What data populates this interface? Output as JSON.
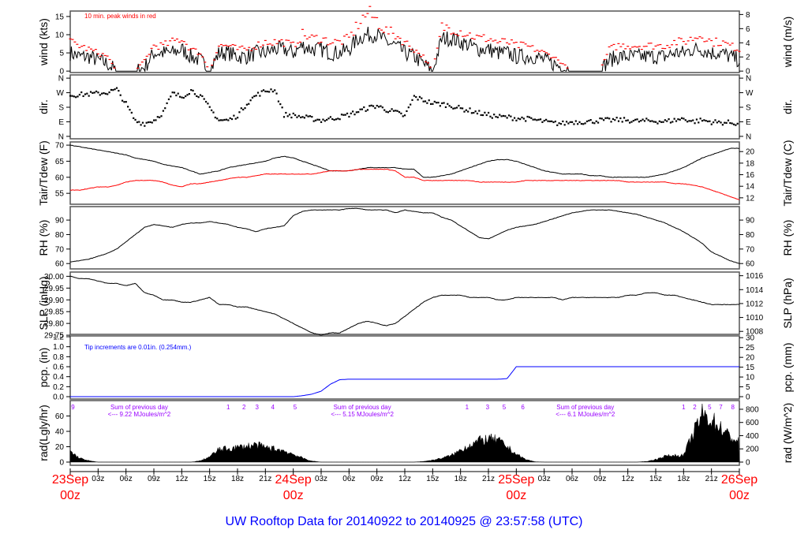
{
  "title": "UW Rooftop Data for 20140922  to  20140925 @ 23:57:58  (UTC)",
  "time_axis": {
    "hours": 72,
    "tick_labels": [
      "03z",
      "06z",
      "09z",
      "12z",
      "15z",
      "18z",
      "21z",
      "03z",
      "06z",
      "09z",
      "12z",
      "15z",
      "18z",
      "21z",
      "03z",
      "06z",
      "09z",
      "12z",
      "15z",
      "18z",
      "21z"
    ],
    "tick_hours": [
      3,
      6,
      9,
      12,
      15,
      18,
      21,
      27,
      30,
      33,
      36,
      39,
      42,
      45,
      51,
      54,
      57,
      60,
      63,
      66,
      69
    ],
    "day_labels": [
      {
        "hour": 0,
        "day": "23Sep",
        "time": "00z"
      },
      {
        "hour": 24,
        "day": "24Sep",
        "time": "00z"
      },
      {
        "hour": 48,
        "day": "25Sep",
        "time": "00z"
      },
      {
        "hour": 72,
        "day": "26Sep",
        "time": "00z"
      }
    ]
  },
  "colors": {
    "main": "#000000",
    "peak": "#ff0000",
    "dew": "#ff0000",
    "pcp": "#0000ff",
    "rad_note": "#9900ff",
    "day": "#ff0000",
    "title": "#0000ff"
  },
  "chart_data": [
    {
      "id": "wind",
      "type": "line",
      "ylabel": "wind (kts)",
      "ylabel_right": "wind (m/s)",
      "yticks": [
        0,
        5,
        10,
        15
      ],
      "yticks_right": [
        0,
        2,
        4,
        6,
        8
      ],
      "ylim": [
        -0.4,
        16.5
      ],
      "annotation": "10 min. peak winds in red",
      "series": [
        {
          "name": "wind",
          "values": [
            5,
            4,
            4,
            3,
            2,
            0,
            0,
            0,
            1,
            5,
            5,
            5,
            6,
            4,
            3,
            0,
            5,
            5,
            4,
            4,
            5,
            5,
            6,
            6,
            5,
            7,
            6,
            6,
            5,
            5,
            6,
            9,
            10,
            10,
            8,
            7,
            5,
            4,
            2,
            0,
            9,
            9,
            8,
            7,
            6,
            6,
            5,
            5,
            4,
            4,
            4,
            3,
            2,
            1,
            0,
            0,
            0,
            0,
            3,
            4,
            4,
            4,
            4,
            4,
            4,
            5,
            5,
            6,
            6,
            5,
            5,
            4,
            3
          ]
        },
        {
          "name": "peak",
          "values": [
            8,
            7,
            6,
            5,
            4,
            0,
            0,
            0,
            3,
            7,
            7,
            8,
            9,
            6,
            5,
            0,
            7,
            7,
            6,
            6,
            7,
            8,
            8,
            8,
            7,
            10,
            9,
            9,
            8,
            8,
            9,
            13,
            16,
            14,
            11,
            10,
            8,
            6,
            4,
            0,
            12,
            12,
            11,
            10,
            9,
            9,
            8,
            8,
            7,
            7,
            6,
            5,
            4,
            2,
            0,
            0,
            0,
            0,
            6,
            7,
            7,
            7,
            7,
            7,
            7,
            8,
            8,
            9,
            10,
            8,
            8,
            7,
            6
          ]
        }
      ]
    },
    {
      "id": "dir",
      "type": "scatter",
      "ylabel": "dir.",
      "ylabel_right": "dir.",
      "yticks": [
        0,
        90,
        180,
        270,
        360
      ],
      "ytick_labels": [
        "N",
        "E",
        "S",
        "W",
        "N"
      ],
      "ylim": [
        -15,
        380
      ],
      "series": [
        {
          "name": "direction",
          "values": [
            255,
            258,
            262,
            266,
            272,
            290,
            200,
            95,
            80,
            100,
            150,
            265,
            245,
            285,
            250,
            175,
            100,
            100,
            130,
            205,
            255,
            280,
            292,
            135,
            130,
            120,
            110,
            100,
            110,
            120,
            135,
            155,
            175,
            190,
            165,
            150,
            125,
            245,
            225,
            205,
            200,
            190,
            172,
            160,
            145,
            132,
            122,
            120,
            112,
            110,
            102,
            92,
            82,
            80,
            90,
            90,
            92,
            100,
            100,
            102,
            100,
            95,
            96,
            95,
            92,
            100,
            110,
            92,
            100,
            90,
            86,
            85,
            80
          ]
        }
      ]
    },
    {
      "id": "temp",
      "type": "line",
      "ylabel": "Tair/Tdew (F)",
      "ylabel_right": "Tair/Tdew (C)",
      "yticks": [
        55,
        60,
        65,
        70
      ],
      "yticks_right": [
        12,
        14,
        16,
        18,
        20
      ],
      "ylim": [
        51.6,
        71
      ],
      "series": [
        {
          "name": "Tair",
          "values": [
            70,
            69.5,
            69,
            68.5,
            68,
            67.5,
            67,
            66,
            65.5,
            65,
            64,
            63.5,
            63,
            62,
            61,
            61.5,
            62,
            63,
            63.5,
            64,
            64.5,
            65,
            66,
            66.5,
            66,
            65,
            64,
            63,
            62,
            62,
            62,
            62.5,
            63,
            63,
            63,
            63,
            62.5,
            62.5,
            60,
            60,
            60.5,
            61,
            62,
            63,
            64,
            65,
            65.5,
            65.5,
            65,
            64,
            63,
            62,
            61.5,
            61,
            61,
            61,
            60.5,
            60.5,
            60,
            60,
            60,
            60,
            60,
            60.5,
            61,
            62,
            63,
            64.5,
            66,
            67,
            68,
            69,
            69
          ]
        },
        {
          "name": "Tdew",
          "values": [
            56,
            56,
            56.5,
            57,
            57,
            57.5,
            58.5,
            59,
            59,
            59,
            58.5,
            57.5,
            57,
            58,
            58,
            58.5,
            59,
            59.5,
            60,
            60,
            60.5,
            61,
            61,
            61,
            61,
            61,
            61,
            61.5,
            62,
            62,
            62,
            62.5,
            62.5,
            62.5,
            62.5,
            62,
            60,
            60,
            59,
            59,
            59,
            59,
            59,
            59,
            58.5,
            58.5,
            58.5,
            58.5,
            58.5,
            59,
            59,
            59,
            59,
            59,
            59,
            59,
            59,
            59,
            59,
            59,
            58.5,
            58.5,
            58.5,
            58.5,
            58.5,
            58,
            58,
            57.5,
            57,
            56,
            55,
            54,
            53
          ]
        }
      ]
    },
    {
      "id": "rh",
      "type": "line",
      "ylabel": "RH (%)",
      "ylabel_right": "RH (%)",
      "yticks": [
        60,
        70,
        80,
        90
      ],
      "yticks_right": [
        60,
        70,
        80,
        90
      ],
      "ylim": [
        56.3,
        99.3
      ],
      "series": [
        {
          "name": "RH",
          "values": [
            61,
            62,
            63,
            65,
            67,
            70,
            75,
            80,
            85,
            87,
            86,
            85,
            87,
            88,
            88,
            89,
            88,
            87,
            85,
            84,
            82,
            84,
            85,
            86,
            93,
            96,
            97,
            97,
            97,
            97,
            98,
            98,
            97,
            97,
            97,
            95,
            97,
            96,
            95,
            95,
            92,
            90,
            86,
            82,
            78,
            77,
            80,
            83,
            85,
            86,
            87,
            89,
            91,
            93,
            95,
            96,
            97,
            97,
            97,
            96,
            95,
            94,
            92,
            90,
            88,
            85,
            82,
            78,
            74,
            68,
            65,
            62,
            60
          ]
        }
      ]
    },
    {
      "id": "slp",
      "type": "line",
      "ylabel": "SLP (inHg)",
      "ylabel_right": "SLP (hPa)",
      "yticks": [
        29.75,
        29.8,
        29.85,
        29.9,
        29.95,
        30.0
      ],
      "yticks_right": [
        1008,
        1010,
        1012,
        1014,
        1016
      ],
      "ylim": [
        29.7536,
        30.018
      ],
      "series": [
        {
          "name": "SLP",
          "values": [
            30.0,
            29.99,
            29.99,
            29.98,
            29.97,
            29.97,
            29.96,
            29.97,
            29.93,
            29.92,
            29.9,
            29.9,
            29.89,
            29.89,
            29.9,
            29.91,
            29.88,
            29.88,
            29.87,
            29.87,
            29.86,
            29.85,
            29.84,
            29.82,
            29.8,
            29.78,
            29.76,
            29.75,
            29.76,
            29.76,
            29.78,
            29.8,
            29.81,
            29.8,
            29.79,
            29.8,
            29.83,
            29.86,
            29.89,
            29.91,
            29.92,
            29.92,
            29.92,
            29.91,
            29.91,
            29.91,
            29.9,
            29.9,
            29.91,
            29.91,
            29.91,
            29.91,
            29.91,
            29.9,
            29.91,
            29.91,
            29.91,
            29.91,
            29.91,
            29.91,
            29.92,
            29.92,
            29.93,
            29.93,
            29.92,
            29.92,
            29.91,
            29.9,
            29.89,
            29.88,
            29.88,
            29.88,
            29.88
          ]
        }
      ]
    },
    {
      "id": "pcp",
      "type": "line",
      "ylabel": "pcp. (in)",
      "ylabel_right": "pcp. (mm)",
      "yticks": [
        0.0,
        0.2,
        0.4,
        0.6,
        0.8,
        1.0,
        1.2
      ],
      "ytick_labels": [
        "0.0",
        "0.2",
        "0.4",
        "0.6",
        "0.8",
        "1.0",
        "1.2"
      ],
      "yticks_right": [
        0,
        5,
        10,
        15,
        20,
        25,
        30
      ],
      "ylim": [
        -0.047,
        1.216
      ],
      "annotation": "Tip increments are 0.01in. (0.254mm.)",
      "series": [
        {
          "name": "precip",
          "values": [
            0,
            0,
            0,
            0,
            0,
            0,
            0,
            0,
            0,
            0,
            0,
            0,
            0,
            0,
            0,
            0,
            0,
            0,
            0,
            0,
            0,
            0,
            0,
            0,
            0,
            0.02,
            0.05,
            0.11,
            0.25,
            0.34,
            0.35,
            0.35,
            0.35,
            0.35,
            0.35,
            0.35,
            0.35,
            0.35,
            0.35,
            0.35,
            0.35,
            0.35,
            0.35,
            0.35,
            0.35,
            0.35,
            0.35,
            0.36,
            0.6,
            0.6,
            0.6,
            0.6,
            0.6,
            0.6,
            0.6,
            0.6,
            0.6,
            0.6,
            0.6,
            0.6,
            0.6,
            0.6,
            0.6,
            0.6,
            0.6,
            0.6,
            0.6,
            0.6,
            0.6,
            0.6,
            0.6,
            0.6,
            0.6
          ]
        }
      ]
    },
    {
      "id": "rad",
      "type": "area",
      "ylabel": "rad(Lgly/hr)",
      "ylabel_right": "rad (W/m^2)",
      "yticks": [
        0,
        20,
        40,
        60
      ],
      "yticks_right": [
        0,
        200,
        400,
        600,
        800
      ],
      "ylim": [
        -48,
        931
      ],
      "series": [
        {
          "name": "radiation",
          "values": [
            160,
            60,
            20,
            0,
            0,
            0,
            0,
            0,
            0,
            0,
            0,
            0,
            0,
            0,
            20,
            80,
            190,
            200,
            220,
            240,
            260,
            220,
            200,
            170,
            120,
            60,
            15,
            0,
            0,
            0,
            0,
            0,
            0,
            0,
            0,
            0,
            0,
            0,
            10,
            30,
            60,
            100,
            180,
            260,
            320,
            350,
            330,
            230,
            120,
            40,
            5,
            0,
            0,
            0,
            0,
            0,
            0,
            0,
            0,
            0,
            0,
            0,
            10,
            40,
            90,
            100,
            100,
            420,
            720,
            640,
            520,
            380,
            300
          ]
        }
      ],
      "notes": [
        {
          "hour": 0.3,
          "text": "9"
        },
        {
          "hour": 17,
          "text": "1"
        },
        {
          "hour": 18.7,
          "text": "2"
        },
        {
          "hour": 20.1,
          "text": "3"
        },
        {
          "hour": 21.8,
          "text": "4"
        },
        {
          "hour": 24.2,
          "text": "5"
        },
        {
          "hour": 42.7,
          "text": "1"
        },
        {
          "hour": 44.9,
          "text": "3"
        },
        {
          "hour": 46.7,
          "text": "5"
        },
        {
          "hour": 48.7,
          "text": "6"
        },
        {
          "hour": 66,
          "text": "1"
        },
        {
          "hour": 67.2,
          "text": "2"
        },
        {
          "hour": 68.8,
          "text": "5"
        },
        {
          "hour": 70,
          "text": "7"
        },
        {
          "hour": 71.3,
          "text": "8"
        }
      ],
      "daily_sums": [
        {
          "hour": 7,
          "line1": "Sum of previous day",
          "line2": "<--- 9.22 MJoules/m^2"
        },
        {
          "hour": 31,
          "line1": "Sum of previous day",
          "line2": "<--- 5.15 MJoules/m^2"
        },
        {
          "hour": 55,
          "line1": "Sum of previous day",
          "line2": "<--- 6.1 MJoules/m^2"
        }
      ]
    }
  ]
}
